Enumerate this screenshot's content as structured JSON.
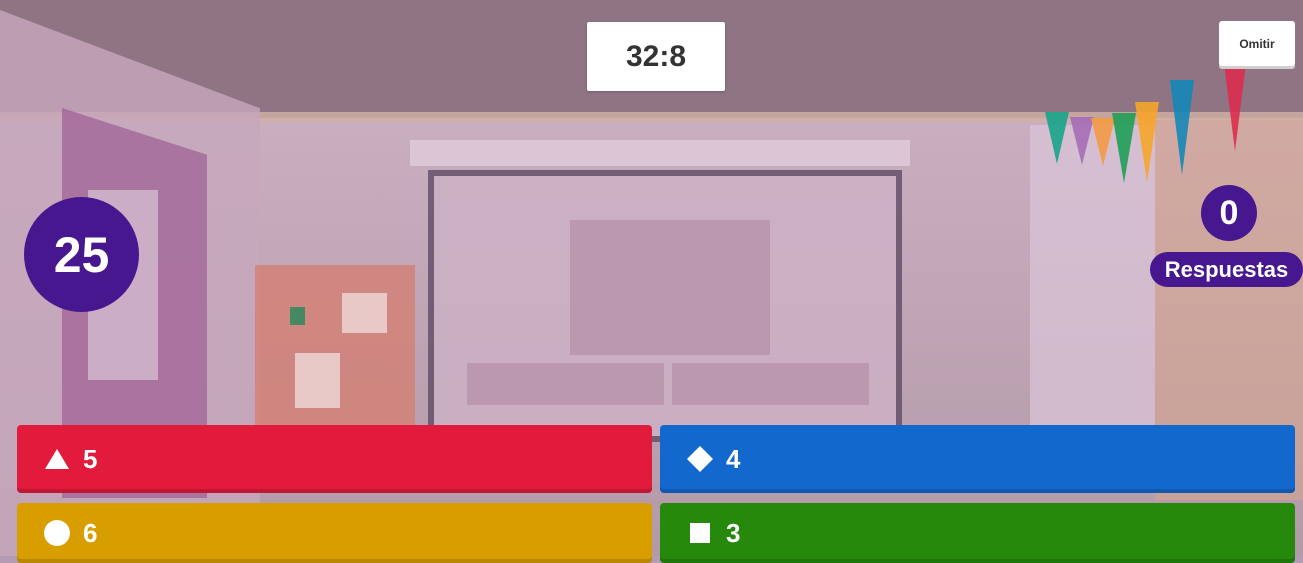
{
  "timer": {
    "value": "32:8"
  },
  "skip_button": {
    "label": "Omitir"
  },
  "question_count": {
    "value": "25"
  },
  "answers_counter": {
    "count": "0",
    "label": "Respuestas"
  },
  "answer_options": [
    {
      "shape": "triangle-icon",
      "value": "5",
      "color": "#e21b3c"
    },
    {
      "shape": "diamond-icon",
      "value": "4",
      "color": "#1368ce"
    },
    {
      "shape": "circle-icon",
      "value": "6",
      "color": "#d89e00"
    },
    {
      "shape": "square-icon",
      "value": "3",
      "color": "#26890c"
    }
  ],
  "colors": {
    "accent_purple": "#46178f",
    "ceiling": "#8f7584",
    "wall": "#c9aebf"
  }
}
